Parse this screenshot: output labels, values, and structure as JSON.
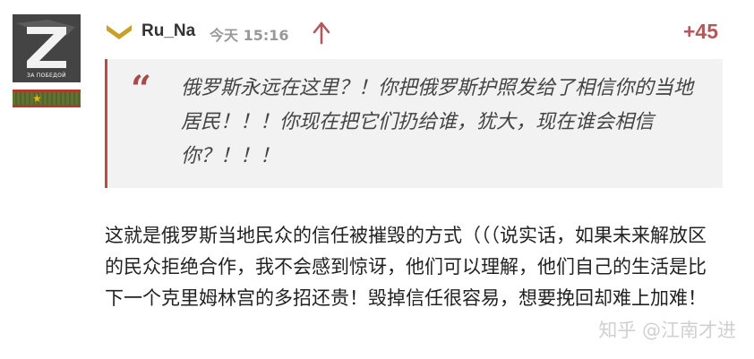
{
  "comment": {
    "avatar": {
      "icon": "z-emblem-avatar",
      "caption": "ЗА ПОБЕДОЙ"
    },
    "rank_badge": {
      "icon": "military-rank-badge"
    },
    "rank_icon": "chevron-rank-icon",
    "username": "Ru_Na",
    "timestamp": "今天 15:16",
    "upvote_icon": "arrow-up-icon",
    "score": "+45",
    "quote": {
      "mark": "“",
      "text": "俄罗斯永远在这里？！你把俄罗斯护照发给了相信你的当地居民！！！你现在把它们扔给谁，犹大，现在谁会相信你？！！！"
    },
    "body": "这就是俄罗斯当地民众的信任被摧毁的方式（（（说实话，如果未来解放区的民众拒绝合作，我不会感到惊讶，他们可以理解，他们自己的生活是比下一个克里姆林宫的多招还贵！毁掉信任很容易，想要挽回却难上加难！"
  },
  "watermark": "知乎 @江南才进",
  "colors": {
    "score": "#b5585a",
    "quote_border": "#b94b4b",
    "rank_icon": "#c8a12a",
    "upvote": "#b5585a"
  }
}
